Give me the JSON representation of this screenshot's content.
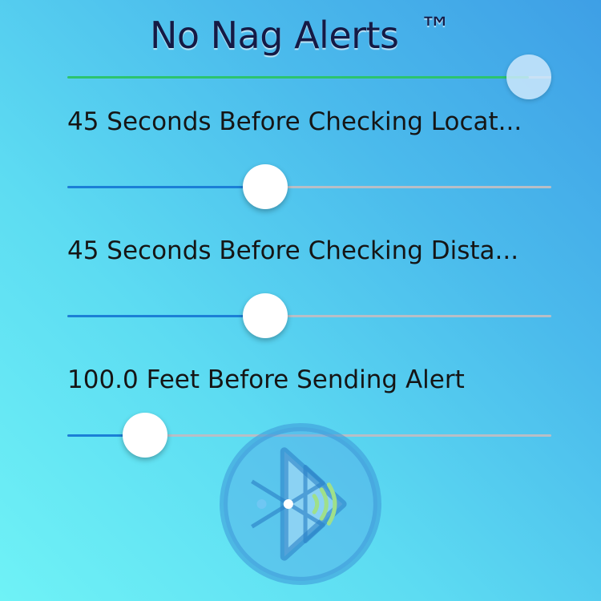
{
  "app": {
    "title": "No Nag Alerts",
    "trademark": "™"
  },
  "colors": {
    "background_top": "#6ff2f6",
    "background_bottom": "#3e9fe6",
    "slider_fill": "#1b7fd6",
    "master_fill": "#2cc46e",
    "track": "#b8bec6"
  },
  "master_slider": {
    "value_fraction": 1.0
  },
  "settings": [
    {
      "label": "45 Seconds Before Checking Locat...",
      "value_fraction": 0.4
    },
    {
      "label": "45 Seconds Before Checking Dista...",
      "value_fraction": 0.4
    },
    {
      "label": "100.0 Feet Before Sending Alert",
      "value_fraction": 0.125
    }
  ],
  "logo": {
    "icon": "bluetooth-play-icon"
  }
}
